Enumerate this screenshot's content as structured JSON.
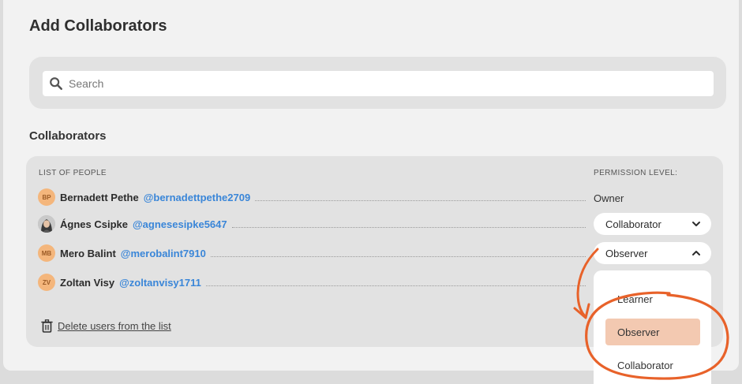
{
  "title": "Add Collaborators",
  "search": {
    "placeholder": "Search"
  },
  "section_title": "Collaborators",
  "list_header": "LIST OF PEOPLE",
  "permission_header": "PERMISSION LEVEL:",
  "people": [
    {
      "initials": "BP",
      "name": "Bernadett Pethe",
      "handle": "@bernadettpethe2709",
      "permission": "Owner"
    },
    {
      "initials": "",
      "name": "Ágnes Csipke",
      "handle": "@agnesesipke5647",
      "permission": "Collaborator"
    },
    {
      "initials": "MB",
      "name": "Mero Balint",
      "handle": "@merobalint7910",
      "permission": "Observer"
    },
    {
      "initials": "ZV",
      "name": "Zoltan Visy",
      "handle": "@zoltanvisy1711",
      "permission": ""
    }
  ],
  "delete_label": "Delete users from the list",
  "dropdown_options": [
    "Learner",
    "Observer",
    "Collaborator"
  ],
  "colors": {
    "accent": "#3a86d8",
    "annotation": "#e8622a",
    "selected_option": "#f3c9b1",
    "avatar": "#f4b67c"
  },
  "icons": {
    "search": "search-icon",
    "trash": "trash-icon",
    "chevron_down": "chevron-down-icon",
    "chevron_up": "chevron-up-icon"
  }
}
